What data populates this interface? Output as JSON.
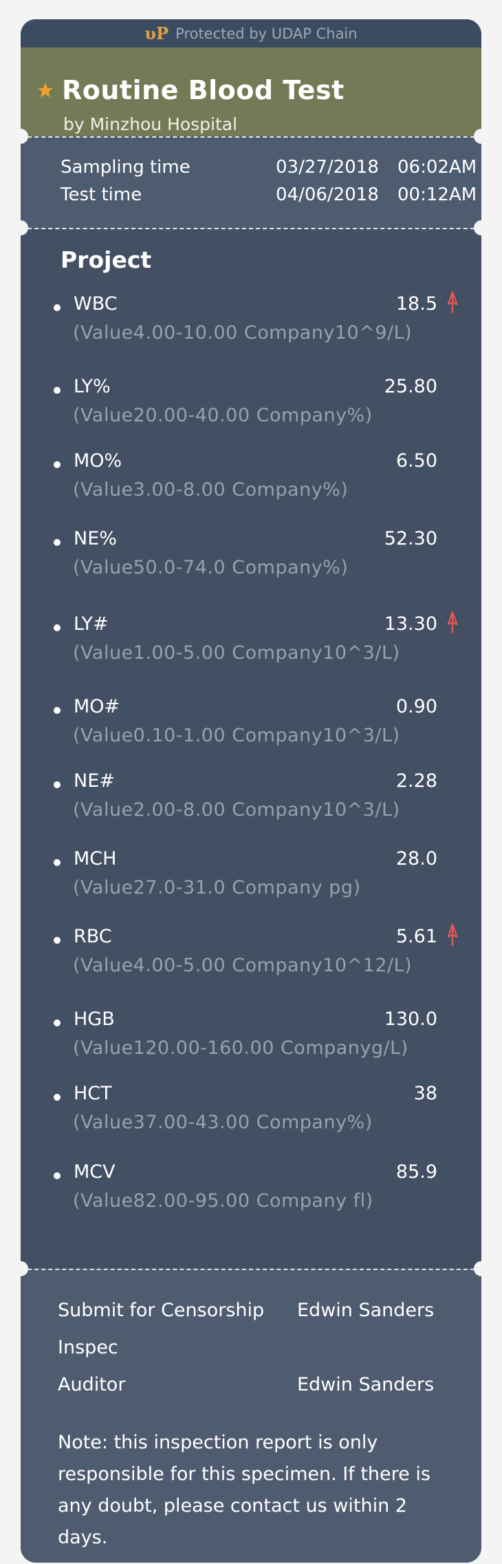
{
  "banner": {
    "logo_icon": "udap-logo-icon",
    "text": "Protected by UDAP Chain"
  },
  "header": {
    "title": "Routine Blood Test",
    "subtitle": "by Minzhou Hospital",
    "icon": "star-icon",
    "icon_color": "#f0a030"
  },
  "times": [
    {
      "label": "Sampling time",
      "date": "03/27/2018",
      "time": "06:02AM"
    },
    {
      "label": "Test time",
      "date": "04/06/2018",
      "time": "00:12AM"
    }
  ],
  "project": {
    "title": "Project",
    "items": [
      {
        "name": "WBC",
        "value": "18.5",
        "range": "(Value4.00-10.00 Company10^9/L)",
        "high": true
      },
      {
        "name": "LY%",
        "value": "25.80",
        "range": "(Value20.00-40.00 Company%)",
        "high": false
      },
      {
        "name": "MO%",
        "value": "6.50",
        "range": "(Value3.00-8.00 Company%)",
        "high": false
      },
      {
        "name": "NE%",
        "value": "52.30",
        "range": "(Value50.0-74.0 Company%)",
        "high": false
      },
      {
        "name": "LY#",
        "value": "13.30",
        "range": "(Value1.00-5.00 Company10^3/L)",
        "high": true
      },
      {
        "name": "MO#",
        "value": "0.90",
        "range": "(Value0.10-1.00 Company10^3/L)",
        "high": false
      },
      {
        "name": "NE#",
        "value": "2.28",
        "range": "(Value2.00-8.00 Company10^3/L)",
        "high": false
      },
      {
        "name": "MCH",
        "value": "28.0",
        "range": "(Value27.0-31.0 Company pg)",
        "high": false
      },
      {
        "name": "RBC",
        "value": "5.61",
        "range": "(Value4.00-5.00 Company10^12/L)",
        "high": true
      },
      {
        "name": "HGB",
        "value": "130.0",
        "range": "(Value120.00-160.00 Companyg/L)",
        "high": false
      },
      {
        "name": "HCT",
        "value": "38",
        "range": "(Value37.00-43.00 Company%)",
        "high": false
      },
      {
        "name": "MCV",
        "value": "85.9",
        "range": "(Value82.00-95.00 Company fl)",
        "high": false
      }
    ],
    "high_icon": "arrow-up-icon",
    "high_color": "#e05a5a"
  },
  "footer": {
    "submit_label": "Submit for Censorship",
    "submit_value": "Edwin Sanders",
    "inspec_label": "Inspec",
    "auditor_label": "Auditor",
    "auditor_value": "Edwin Sanders",
    "note": "Note: this inspection report is only responsible for this specimen. If there is any doubt, please contact us within 2 days."
  }
}
